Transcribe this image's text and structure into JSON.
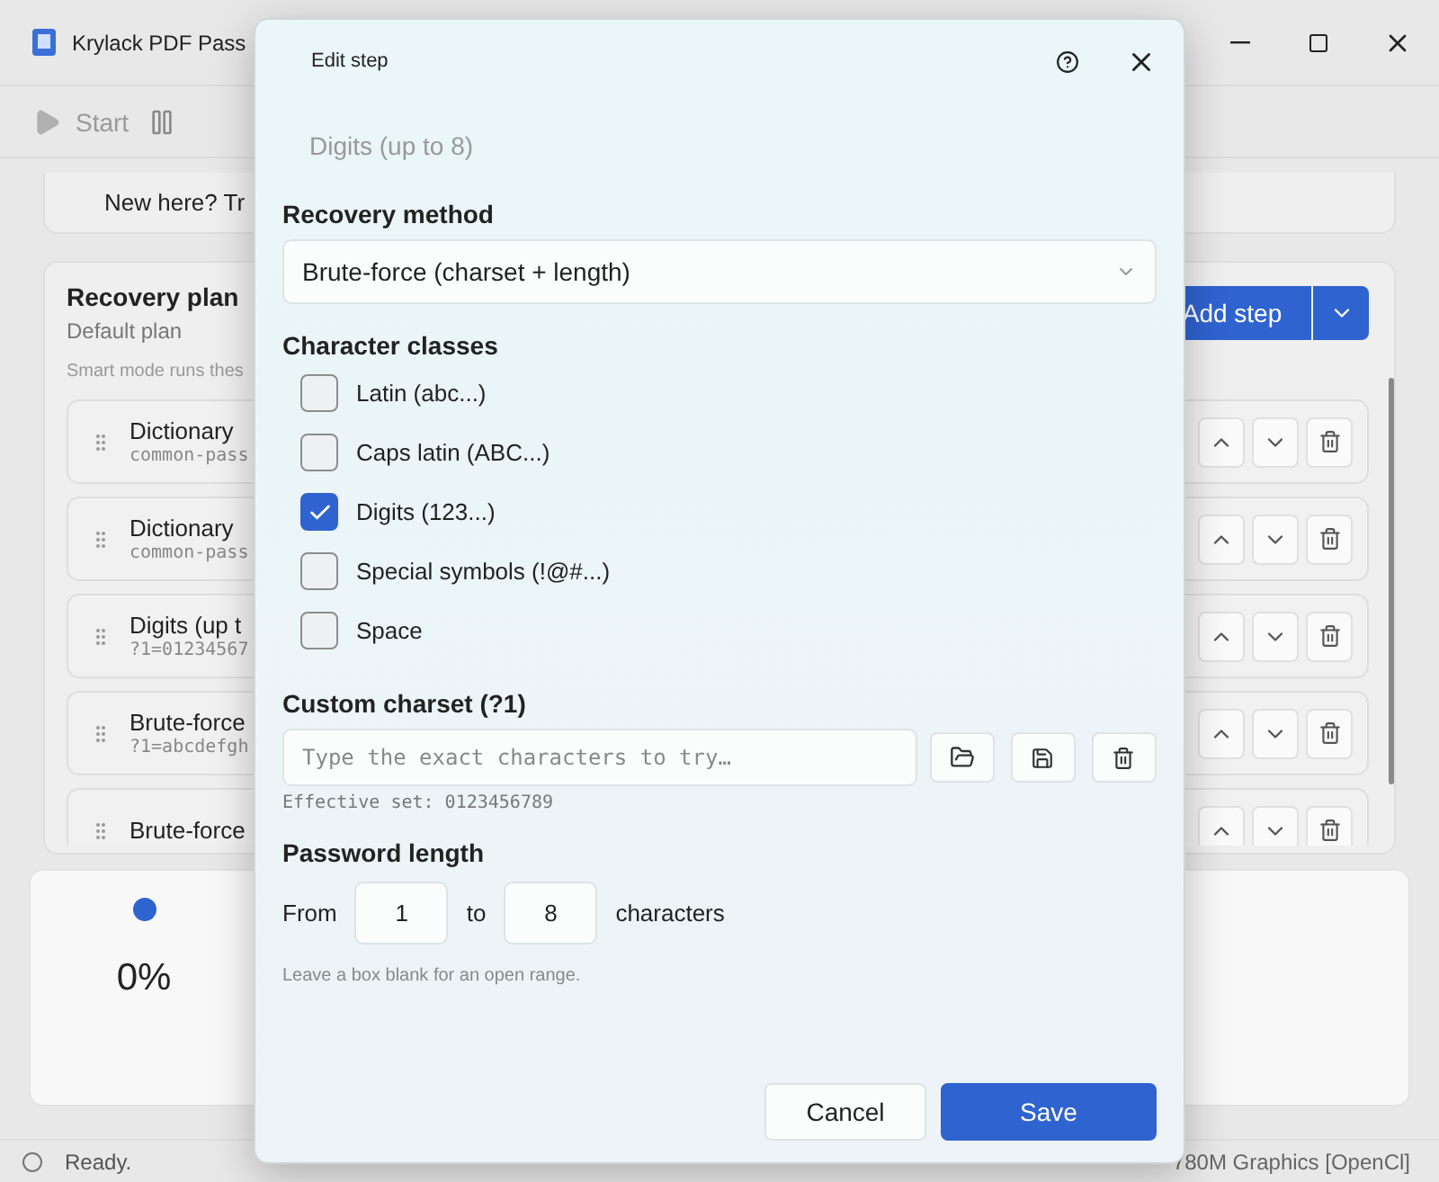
{
  "window": {
    "title": "Krylack PDF Pass"
  },
  "toolbar": {
    "start": {
      "label": "Start",
      "disabled": true
    }
  },
  "banner": {
    "text": "New here? Tr"
  },
  "plan": {
    "title": "Recovery plan",
    "subtitle": "Default plan",
    "note": "Smart mode runs thes",
    "add_button": "Add step",
    "steps": [
      {
        "name": "Dictionary",
        "detail": "common-pass"
      },
      {
        "name": "Dictionary",
        "detail": "common-pass"
      },
      {
        "name": "Digits (up t",
        "detail": "?1=01234567"
      },
      {
        "name": "Brute-force",
        "detail": "?1=abcdefgh"
      },
      {
        "name": "Brute-force"
      }
    ]
  },
  "progress": {
    "percent": "0%"
  },
  "status_bar": {
    "status": "Ready.",
    "device": "780M Graphics [OpenCl]"
  },
  "dialog": {
    "title": "Edit step",
    "step_name": "Digits (up to 8)",
    "method_label": "Recovery method",
    "method_value": "Brute-force (charset + length)",
    "classes_label": "Character classes",
    "classes": [
      {
        "label": "Latin (abc...)",
        "checked": false
      },
      {
        "label": "Caps latin (ABC...)",
        "checked": false
      },
      {
        "label": "Digits (123...)",
        "checked": true
      },
      {
        "label": "Special symbols (!@#...)",
        "checked": false
      },
      {
        "label": "Space",
        "checked": false
      }
    ],
    "charset_label": "Custom charset (?1)",
    "charset_placeholder": "Type the exact characters to try…",
    "effective": "Effective set: 0123456789",
    "length_label": "Password length",
    "from_label": "From",
    "from_value": "1",
    "to_label": "to",
    "to_value": "8",
    "unit": "characters",
    "hint": "Leave a box blank for an open range.",
    "cancel": "Cancel",
    "save": "Save"
  }
}
